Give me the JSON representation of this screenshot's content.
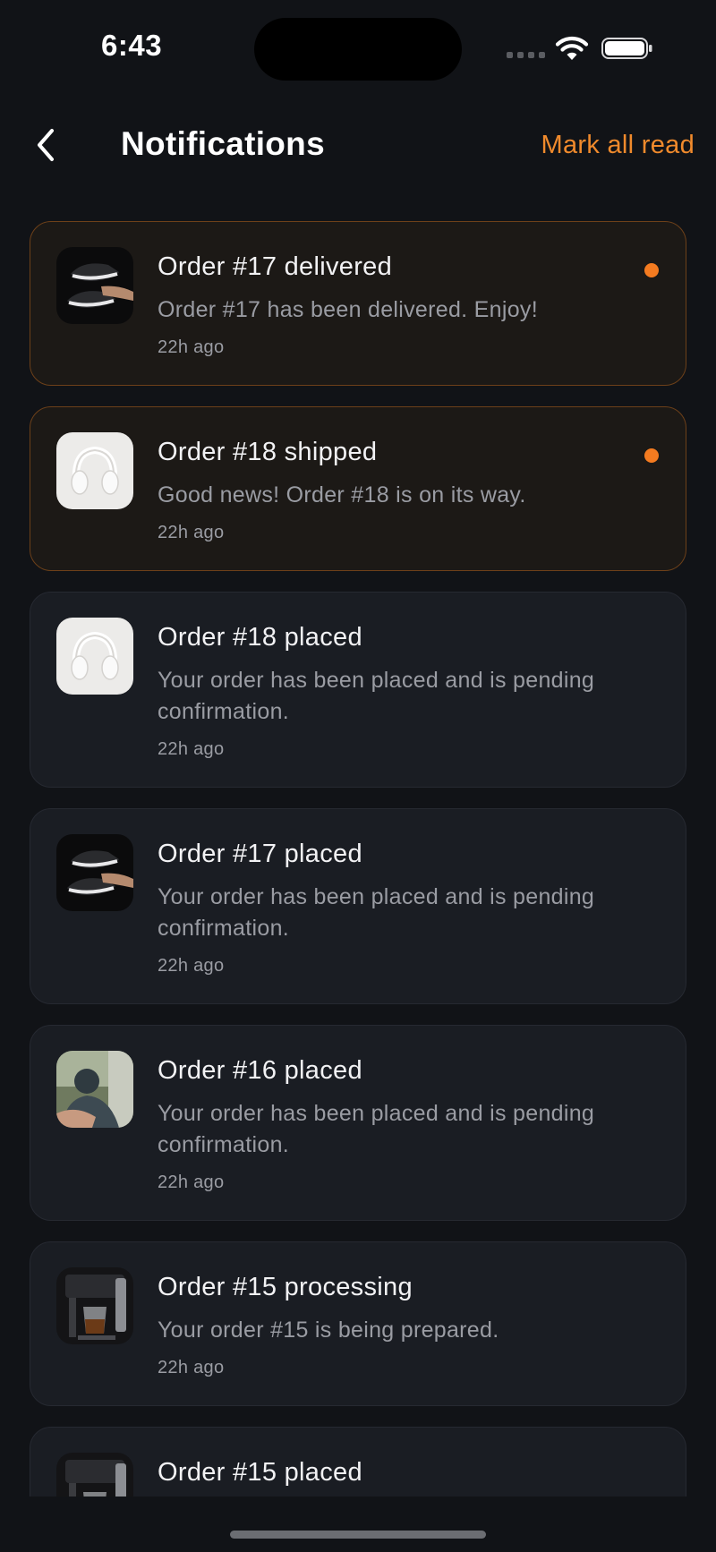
{
  "status_bar": {
    "time": "6:43"
  },
  "header": {
    "title": "Notifications",
    "mark_all_label": "Mark all read",
    "accent": "#f08a2c"
  },
  "notifications": [
    {
      "title": "Order #17 delivered",
      "message": "Order #17 has been delivered. Enjoy!",
      "time": "22h ago",
      "unread": true,
      "thumbnail": "sneakers-image"
    },
    {
      "title": "Order #18 shipped",
      "message": "Good news! Order #18 is on its way.",
      "time": "22h ago",
      "unread": true,
      "thumbnail": "headphones-image"
    },
    {
      "title": "Order #18 placed",
      "message": "Your order has been placed and is pending confirmation.",
      "time": "22h ago",
      "unread": false,
      "thumbnail": "headphones-image"
    },
    {
      "title": "Order #17 placed",
      "message": "Your order has been placed and is pending confirmation.",
      "time": "22h ago",
      "unread": false,
      "thumbnail": "sneakers-image"
    },
    {
      "title": "Order #16 placed",
      "message": "Your order has been placed and is pending confirmation.",
      "time": "22h ago",
      "unread": false,
      "thumbnail": "photo-image"
    },
    {
      "title": "Order #15 processing",
      "message": "Your order #15 is being prepared.",
      "time": "22h ago",
      "unread": false,
      "thumbnail": "coffee-machine-image"
    },
    {
      "title": "Order #15 placed",
      "message": "",
      "time": "",
      "unread": false,
      "thumbnail": "coffee-machine-image"
    }
  ]
}
